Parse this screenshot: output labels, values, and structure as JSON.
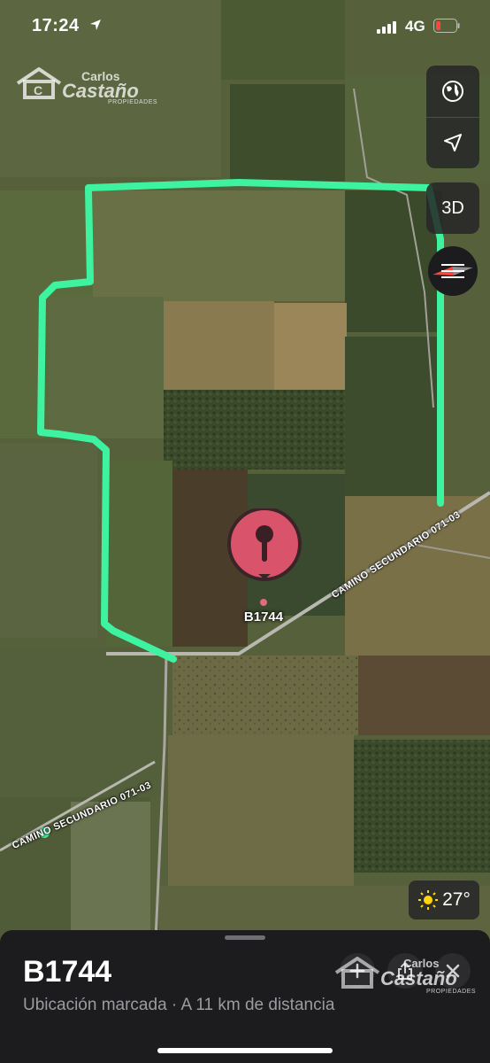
{
  "status_bar": {
    "time": "17:24",
    "network": "4G",
    "icons": [
      "location-arrow-icon",
      "signal-icon",
      "battery-icon"
    ]
  },
  "watermark": {
    "line1": "Carlos",
    "line2": "Castaño",
    "line3": "PROPIEDADES"
  },
  "map": {
    "controls": {
      "globe": "globe-icon",
      "locate": "location-arrow-icon",
      "three_d_label": "3D",
      "compass": "compass-icon"
    },
    "road_labels": [
      "CAMINO SECUNDARIO 071-03",
      "CAMINO SECUNDARIO 071-03"
    ],
    "pin_label": "B1744",
    "boundary_color": "#3ef3a0",
    "pin_color": "#e36b7a"
  },
  "weather": {
    "icon": "sun-icon",
    "temperature": "27°"
  },
  "sheet": {
    "title": "B1744",
    "subtitle": "Ubicación marcada · A 11 km de distancia",
    "actions": [
      "add-icon",
      "share-icon",
      "close-icon"
    ]
  }
}
